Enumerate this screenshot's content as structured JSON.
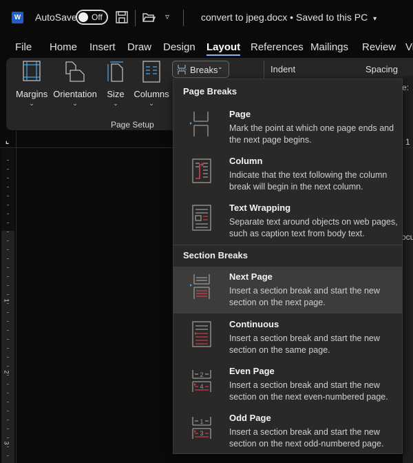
{
  "titlebar": {
    "app_icon_letter": "W",
    "autosave_label": "AutoSave",
    "autosave_state": "Off",
    "document_title": "convert to jpeg.docx • Saved to this PC",
    "title_chevron": "▾"
  },
  "tabs": [
    {
      "label": "File",
      "active": false
    },
    {
      "label": "Home",
      "active": false
    },
    {
      "label": "Insert",
      "active": false
    },
    {
      "label": "Draw",
      "active": false
    },
    {
      "label": "Design",
      "active": false
    },
    {
      "label": "Layout",
      "active": true
    },
    {
      "label": "References",
      "active": false
    },
    {
      "label": "Mailings",
      "active": false
    },
    {
      "label": "Review",
      "active": false
    },
    {
      "label": "Vi",
      "active": false
    }
  ],
  "ribbon": {
    "buttons": [
      {
        "label": "Margins",
        "chevron": "⌄"
      },
      {
        "label": "Orientation",
        "chevron": "⌄"
      },
      {
        "label": "Size",
        "chevron": "⌄"
      },
      {
        "label": "Columns",
        "chevron": "⌄"
      }
    ],
    "group_label": "Page Setup",
    "breaks_label": "Breaks",
    "breaks_chevron": "⌄",
    "indent_label": "Indent",
    "spacing_label": "Spacing"
  },
  "ruler": {
    "numbers": [
      "1",
      "2",
      "3"
    ]
  },
  "right_snippets": {
    "label_e": "e:",
    "one": "1",
    "ocu": "ocu"
  },
  "dropdown": {
    "page_breaks_header": "Page Breaks",
    "section_breaks_header": "Section Breaks",
    "page_breaks": [
      {
        "title": "Page",
        "description": "Mark the point at which one page ends and the next page begins.",
        "icon": "page-break-icon"
      },
      {
        "title": "Column",
        "description": "Indicate that the text following the column break will begin in the next column.",
        "icon": "column-break-icon"
      },
      {
        "title": "Text Wrapping",
        "description": "Separate text around objects on web pages, such as caption text from body text.",
        "icon": "text-wrapping-icon"
      }
    ],
    "section_breaks": [
      {
        "title": "Next Page",
        "description": "Insert a section break and start the new section on the next page.",
        "icon": "next-page-icon",
        "highlighted": true
      },
      {
        "title": "Continuous",
        "description": "Insert a section break and start the new section on the same page.",
        "icon": "continuous-icon",
        "highlighted": false
      },
      {
        "title": "Even Page",
        "description": "Insert a section break and start the new section on the next even-numbered page.",
        "icon": "even-page-icon",
        "highlighted": false
      },
      {
        "title": "Odd Page",
        "description": "Insert a section break and start the new section on the next odd-numbered page.",
        "icon": "odd-page-icon",
        "highlighted": false
      }
    ],
    "even_icon_numbers": [
      "2",
      "4"
    ],
    "odd_icon_numbers": [
      "1",
      "3"
    ]
  },
  "colors": {
    "accent_blue": "#4aa3df",
    "break_red": "#c8404a",
    "hover_bg": "#3e3c3b",
    "menu_bg": "#2b2928"
  }
}
